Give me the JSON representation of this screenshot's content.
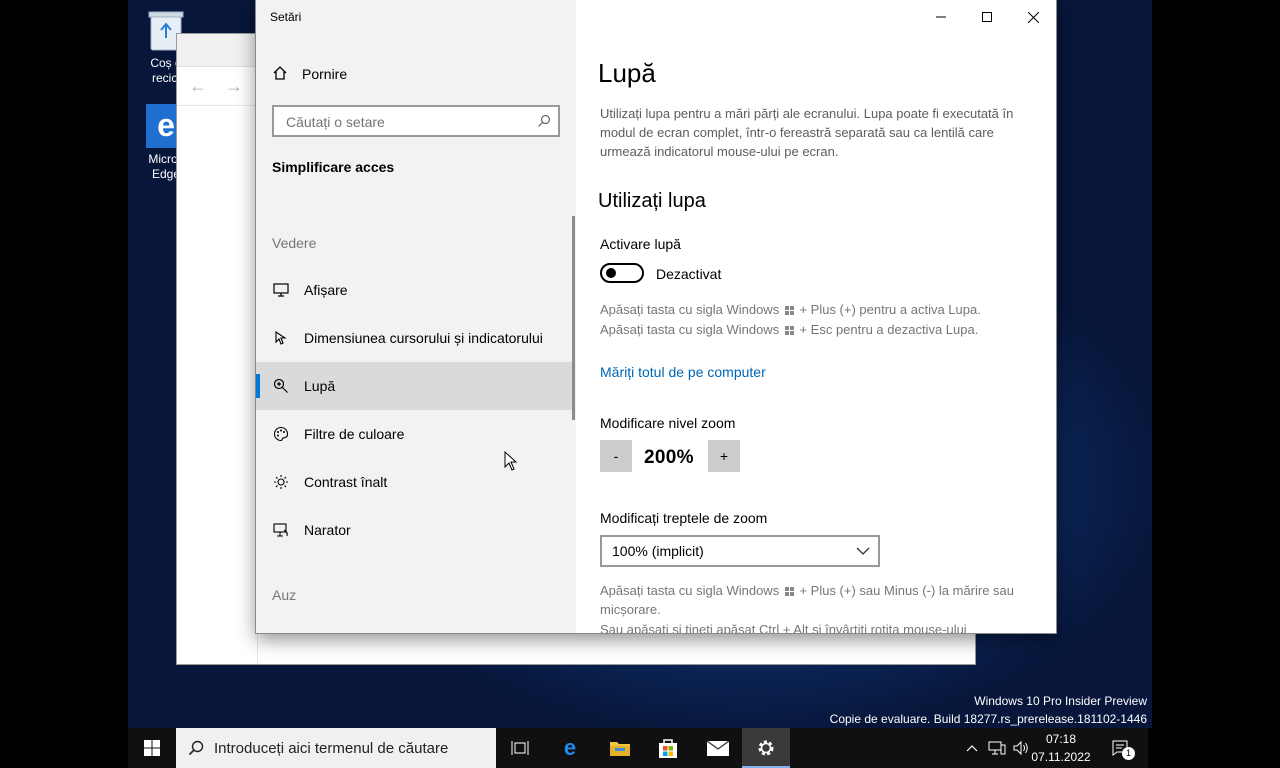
{
  "desktop": {
    "icons": [
      {
        "label_line1": "Coș d",
        "label_line2": "recicl"
      },
      {
        "label_line1": "Micros",
        "label_line2": "Edge"
      }
    ],
    "watermark_line1": "Windows 10 Pro Insider Preview",
    "watermark_line2": "Copie de evaluare. Build 18277.rs_prerelease.181102-1446"
  },
  "settings": {
    "window_title": "Setări",
    "home_label": "Pornire",
    "search_placeholder": "Căutați o setare",
    "section_title": "Simplificare acces",
    "groups": {
      "vision": "Vedere",
      "hearing": "Auz"
    },
    "nav_items": [
      {
        "label": "Afișare",
        "icon": "display-icon"
      },
      {
        "label": "Dimensiunea cursorului și indicatorului",
        "icon": "cursor-icon"
      },
      {
        "label": "Lupă",
        "icon": "magnifier-icon",
        "selected": true
      },
      {
        "label": "Filtre de culoare",
        "icon": "palette-icon"
      },
      {
        "label": "Contrast înalt",
        "icon": "brightness-icon"
      },
      {
        "label": "Narator",
        "icon": "narrator-icon"
      }
    ],
    "page_title": "Lupă",
    "page_description": "Utilizați lupa pentru a mări părți ale ecranului. Lupa poate fi executată în modul de ecran complet, într-o fereastră separată sau ca lentilă care urmează indicatorul mouse-ului pe ecran.",
    "subheading": "Utilizați lupa",
    "toggle_label": "Activare lupă",
    "toggle_state": "Dezactivat",
    "hint_on_a": "Apăsați tasta cu sigla Windows",
    "hint_on_b": "+ Plus (+) pentru a activa Lupa.",
    "hint_off_a": "Apăsați tasta cu sigla Windows",
    "hint_off_b": "+ Esc pentru a dezactiva Lupa.",
    "link_text": "Măriți totul de pe computer",
    "zoom_label": "Modificare nivel zoom",
    "zoom_minus": "-",
    "zoom_value": "200%",
    "zoom_plus": "+",
    "increment_label": "Modificați treptele de zoom",
    "increment_value": "100% (implicit)",
    "hint_zoom_a": "Apăsați tasta cu sigla Windows",
    "hint_zoom_b": "+ Plus (+) sau Minus (-) la mărire sau micșorare.",
    "hint_cut": "Sau apăsați și țineți apăsat Ctrl + Alt și învârtiți rotița mouse-ului"
  },
  "taskbar": {
    "search_placeholder": "Introduceți aici termenul de căutare",
    "time": "07:18",
    "date": "07.11.2022",
    "notification_count": "1"
  },
  "colors": {
    "accent": "#0078d7",
    "link": "#0066b4",
    "sidebar_bg": "#f2f2f2",
    "selected_bg": "#dadada"
  }
}
